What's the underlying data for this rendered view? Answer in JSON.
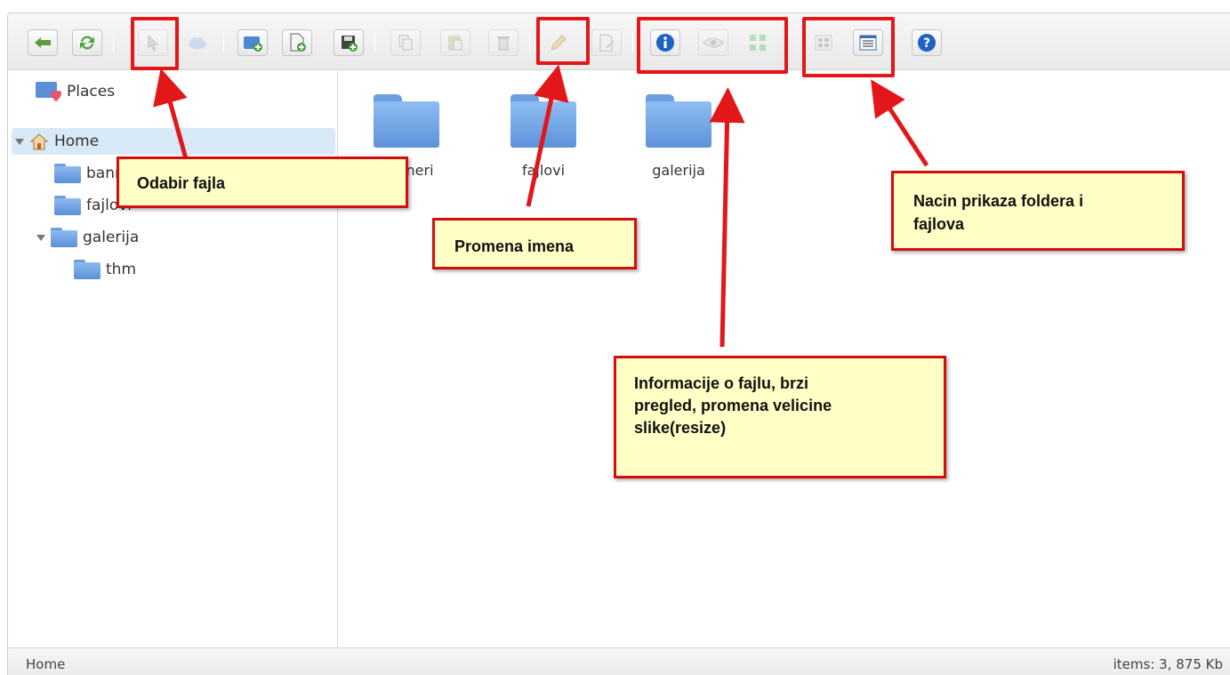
{
  "toolbar": {
    "buttons": [
      {
        "name": "back-button",
        "icon": "arrow-left-icon"
      },
      {
        "name": "reload-button",
        "icon": "refresh-icon"
      },
      {
        "name": "select-file-button",
        "icon": "cursor-icon"
      },
      {
        "name": "open-button",
        "icon": "cloud-icon"
      },
      {
        "name": "new-folder-button",
        "icon": "new-folder-icon"
      },
      {
        "name": "new-file-button",
        "icon": "new-file-icon"
      },
      {
        "name": "upload-button",
        "icon": "upload-icon"
      },
      {
        "name": "copy-button",
        "icon": "copy-icon"
      },
      {
        "name": "paste-button",
        "icon": "paste-icon"
      },
      {
        "name": "delete-button",
        "icon": "trash-icon"
      },
      {
        "name": "rename-button",
        "icon": "pencil-icon"
      },
      {
        "name": "edit-button",
        "icon": "edit-icon"
      },
      {
        "name": "info-button",
        "icon": "info-icon"
      },
      {
        "name": "preview-button",
        "icon": "eye-icon"
      },
      {
        "name": "resize-button",
        "icon": "resize-icon"
      },
      {
        "name": "view-icons-button",
        "icon": "grid-view-icon"
      },
      {
        "name": "view-list-button",
        "icon": "list-view-icon"
      },
      {
        "name": "help-button",
        "icon": "help-icon"
      }
    ]
  },
  "sidebar": {
    "places_label": "Places",
    "home_label": "Home",
    "items": [
      {
        "label": "banneri"
      },
      {
        "label": "fajlovi"
      },
      {
        "label": "galerija"
      },
      {
        "label": "thm"
      }
    ]
  },
  "content": {
    "folders": [
      {
        "label": "banneri"
      },
      {
        "label": "fajlovi"
      },
      {
        "label": "galerija"
      }
    ]
  },
  "status": {
    "path": "Home",
    "summary": "items: 3, 875 Kb"
  },
  "annotations": {
    "select_file": "Odabir fajla",
    "rename": "Promena imena",
    "info_line1": "Informacije o fajlu, brzi",
    "info_line2": "pregled, promena velicine",
    "info_line3": "slike(resize)",
    "view_line1": "Nacin prikaza foldera i",
    "view_line2": "fajlova"
  },
  "colors": {
    "annotation_border": "#d40e0e",
    "annotation_bg": "#ffffc6",
    "folder_blue": "#6c9fe0",
    "selection": "#d8e9f7"
  }
}
